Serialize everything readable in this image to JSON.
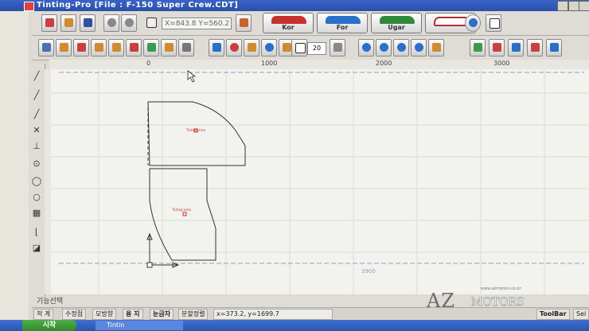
{
  "window": {
    "title": "Tinting-Pro [File : F-150 Super Crew.CDT]"
  },
  "toolbar": {
    "coords": "X=843.8 Y=560.2",
    "car_buttons": [
      {
        "label": "Kor",
        "color": "#c83030"
      },
      {
        "label": "For",
        "color": "#2a6fc8"
      },
      {
        "label": "Ugar",
        "color": "#2f8a3a"
      },
      {
        "label": "",
        "color": "#b03030"
      }
    ],
    "font_size": "20"
  },
  "ruler": {
    "ticks": [
      "0",
      "1000",
      "2000",
      "3000"
    ]
  },
  "canvas": {
    "piece_label_1": "Tinting area",
    "piece_label_2": "Tinting area",
    "dimension": "3900"
  },
  "status": {
    "mode_label": "기능선택",
    "cells": [
      "적 계",
      "수정점",
      "모방향",
      "용 지",
      "눈금자",
      "분할정렬"
    ],
    "cursor": "x=373.2, y=1699.7",
    "toolbar_cell": "ToolBar",
    "sel_cell": "Sel"
  },
  "taskbar": {
    "start": "시작",
    "task": "Tintin"
  },
  "watermark": {
    "url": "www.azmotors.co.kr",
    "brand_az": "AZ",
    "brand_motors": "MOTORS"
  }
}
